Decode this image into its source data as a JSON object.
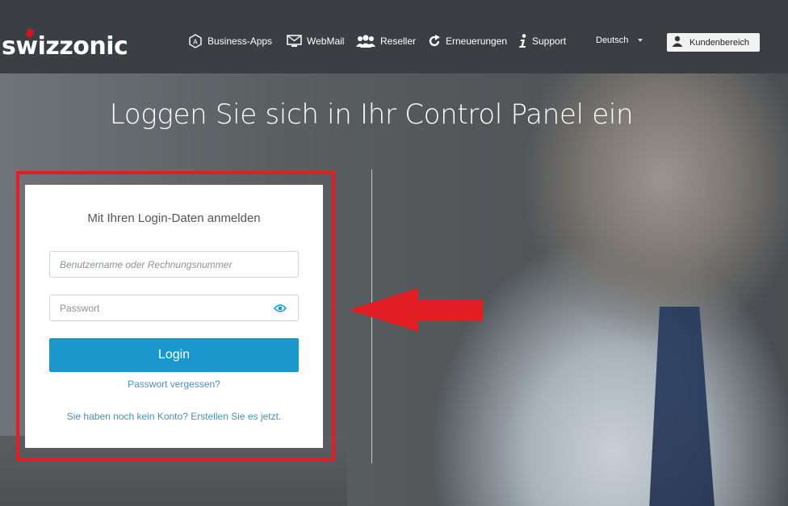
{
  "brand": {
    "logo_text": "swizzonic",
    "accent_color": "#d6141e"
  },
  "nav": {
    "items": [
      {
        "label": "Business-Apps",
        "icon": "business-apps-icon"
      },
      {
        "label": "WebMail",
        "icon": "mail-icon"
      },
      {
        "label": "Reseller",
        "icon": "users-icon"
      },
      {
        "label": "Erneuerungen",
        "icon": "refresh-icon"
      },
      {
        "label": "Support",
        "icon": "info-icon"
      }
    ],
    "language": "Deutsch",
    "customer_area_label": "Kundenbereich"
  },
  "hero": {
    "title": "Loggen Sie sich in Ihr Control Panel ein"
  },
  "login": {
    "title": "Mit Ihren Login-Daten anmelden",
    "username_placeholder": "Benutzername oder Rechnungsnummer",
    "username_value": "",
    "password_placeholder": "Passwort",
    "password_value": "",
    "submit_label": "Login",
    "forgot_link": "Passwort vergessen?",
    "register_link": "Sie haben noch kein Konto? Erstellen Sie es jetzt.",
    "button_color": "#1a98cd",
    "link_color": "#4d8fb8"
  },
  "annotation": {
    "highlight_color": "#e31d24"
  }
}
